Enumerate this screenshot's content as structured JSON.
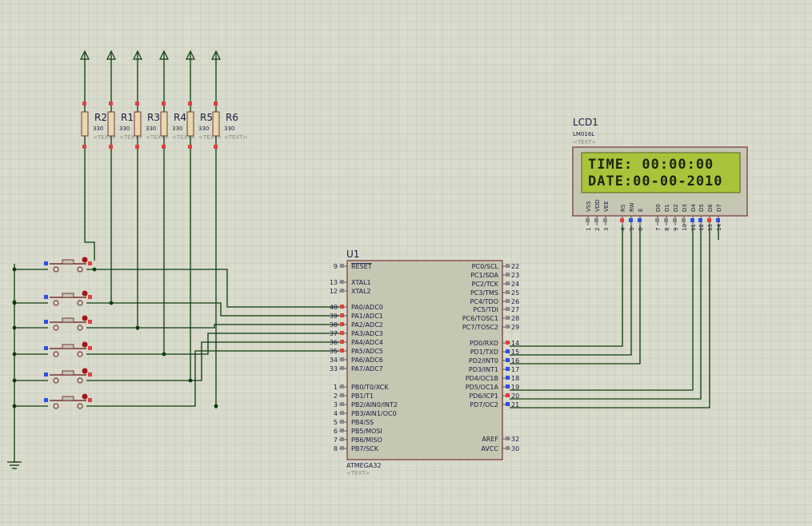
{
  "colors": {
    "background": "#d9dbcc",
    "grid": "#c3c5b6",
    "wire": "#0b3d0b",
    "body": "#c6c7b2",
    "pin_red": "#e04040",
    "pin_blue": "#3050e0",
    "pin_gray": "#8a8a8a",
    "lcd_screen": "#a9c43a"
  },
  "mcu": {
    "ref": "U1",
    "part": "ATMEGA32",
    "text_placeholder": "<TEXT>",
    "left_pins": [
      {
        "num": "9",
        "name": "RESET"
      },
      {
        "num": "13",
        "name": "XTAL1"
      },
      {
        "num": "12",
        "name": "XTAL2"
      },
      {
        "num": "40",
        "name": "PA0/ADC0"
      },
      {
        "num": "39",
        "name": "PA1/ADC1"
      },
      {
        "num": "38",
        "name": "PA2/ADC2"
      },
      {
        "num": "37",
        "name": "PA3/ADC3"
      },
      {
        "num": "36",
        "name": "PA4/ADC4"
      },
      {
        "num": "35",
        "name": "PA5/ADC5"
      },
      {
        "num": "34",
        "name": "PA6/ADC6"
      },
      {
        "num": "33",
        "name": "PA7/ADC7"
      },
      {
        "num": "1",
        "name": "PB0/T0/XCK"
      },
      {
        "num": "2",
        "name": "PB1/T1"
      },
      {
        "num": "3",
        "name": "PB2/AIN0/INT2"
      },
      {
        "num": "4",
        "name": "PB3/AIN1/OC0"
      },
      {
        "num": "5",
        "name": "PB4/SS"
      },
      {
        "num": "6",
        "name": "PB5/MOSI"
      },
      {
        "num": "7",
        "name": "PB6/MISO"
      },
      {
        "num": "8",
        "name": "PB7/SCK"
      }
    ],
    "right_pins": [
      {
        "num": "22",
        "name": "PC0/SCL"
      },
      {
        "num": "23",
        "name": "PC1/SDA"
      },
      {
        "num": "24",
        "name": "PC2/TCK"
      },
      {
        "num": "25",
        "name": "PC3/TMS"
      },
      {
        "num": "26",
        "name": "PC4/TDO"
      },
      {
        "num": "27",
        "name": "PC5/TDI"
      },
      {
        "num": "28",
        "name": "PC6/TOSC1"
      },
      {
        "num": "29",
        "name": "PC7/TOSC2"
      },
      {
        "num": "14",
        "name": "PD0/RXD"
      },
      {
        "num": "15",
        "name": "PD1/TXD"
      },
      {
        "num": "16",
        "name": "PD2/INT0"
      },
      {
        "num": "17",
        "name": "PD3/INT1"
      },
      {
        "num": "18",
        "name": "PD4/OC1B"
      },
      {
        "num": "19",
        "name": "PD5/OC1A"
      },
      {
        "num": "20",
        "name": "PD6/ICP1"
      },
      {
        "num": "21",
        "name": "PD7/OC2"
      },
      {
        "num": "32",
        "name": "AREF"
      },
      {
        "num": "30",
        "name": "AVCC"
      }
    ]
  },
  "lcd": {
    "ref": "LCD1",
    "part": "LM016L",
    "text_placeholder": "<TEXT>",
    "line1": "TIME: 00:00:00",
    "line2": "DATE:00-00-2010",
    "pin_names": [
      "VSS",
      "VDD",
      "VEE",
      "RS",
      "RW",
      "E",
      "D0",
      "D1",
      "D2",
      "D3",
      "D4",
      "D5",
      "D6",
      "D7"
    ],
    "pin_numbers": [
      "1",
      "2",
      "3",
      "4",
      "5",
      "6",
      "7",
      "8",
      "9",
      "10",
      "11",
      "12",
      "13",
      "14"
    ]
  },
  "resistors": [
    {
      "ref": "R2",
      "value": "330",
      "placeholder": "<TEXT>"
    },
    {
      "ref": "R1",
      "value": "330",
      "placeholder": "<TEXT>"
    },
    {
      "ref": "R3",
      "value": "330",
      "placeholder": "<TEXT>"
    },
    {
      "ref": "R4",
      "value": "330",
      "placeholder": "<TEXT>"
    },
    {
      "ref": "R5",
      "value": "330",
      "placeholder": "<TEXT>"
    },
    {
      "ref": "R6",
      "value": "330",
      "placeholder": "<TEXT>"
    }
  ]
}
